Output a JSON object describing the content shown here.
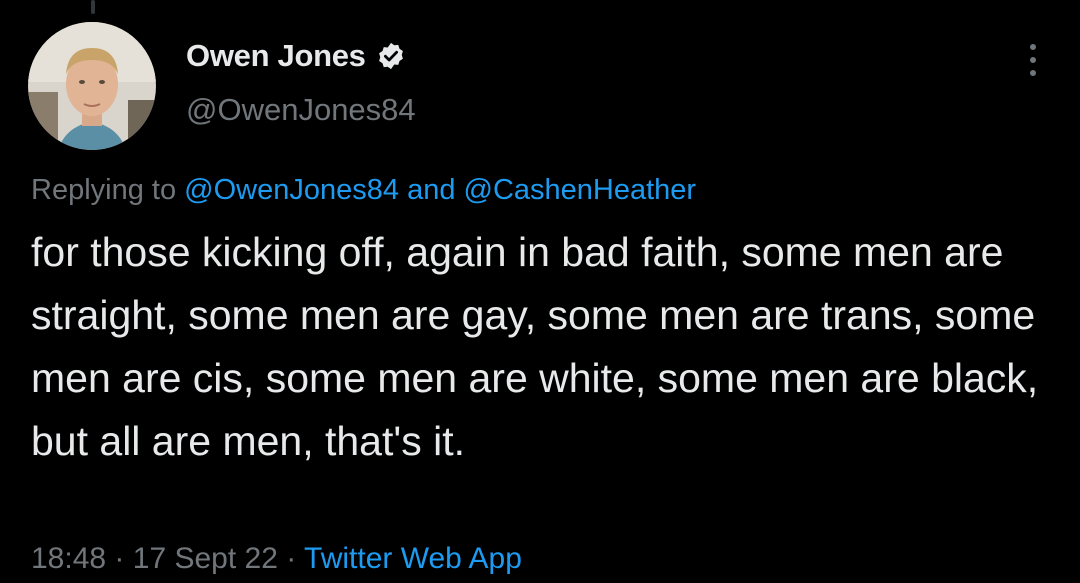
{
  "author": {
    "display_name": "Owen Jones",
    "handle": "@OwenJones84",
    "verified": true
  },
  "reply": {
    "prefix": "Replying to",
    "mention_1": "@OwenJones84",
    "conjunction": "and",
    "mention_2": "@CashenHeather"
  },
  "tweet": {
    "text": "for those kicking off, again in bad faith, some men are straight, some men are gay, some men are trans, some men are cis, some men are white, some men are black, but all are men, that's it."
  },
  "meta": {
    "time": "18:48",
    "separator": "·",
    "date": "17 Sept 22",
    "source": "Twitter Web App"
  },
  "icons": {
    "verified": "verified-badge-icon",
    "more": "more-options-icon"
  },
  "colors": {
    "background": "#000000",
    "primary_text": "#e7e9ea",
    "secondary_text": "#71767b",
    "link": "#1d9bf0"
  }
}
